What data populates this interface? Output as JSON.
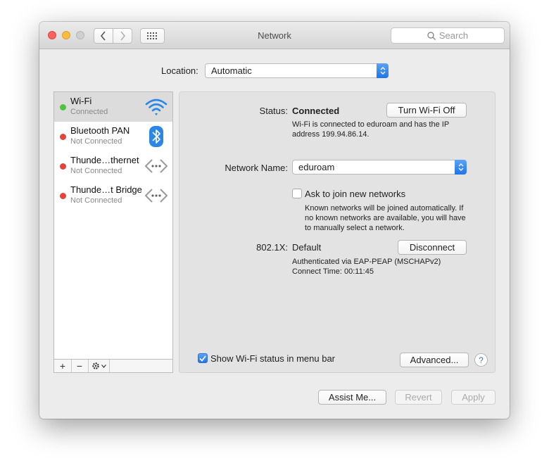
{
  "window": {
    "title": "Network"
  },
  "search": {
    "placeholder": "Search"
  },
  "location": {
    "label": "Location:",
    "value": "Automatic"
  },
  "services": [
    {
      "name": "Wi-Fi",
      "status": "Connected",
      "state": "green",
      "icon": "wifi-icon"
    },
    {
      "name": "Bluetooth PAN",
      "status": "Not Connected",
      "state": "red",
      "icon": "bluetooth-icon"
    },
    {
      "name": "Thunde…thernet",
      "status": "Not Connected",
      "state": "red",
      "icon": "thunderbolt-ethernet-icon"
    },
    {
      "name": "Thunde…t Bridge",
      "status": "Not Connected",
      "state": "red",
      "icon": "thunderbolt-bridge-icon"
    }
  ],
  "sidebar_toolbar": {
    "add": "+",
    "remove": "−"
  },
  "detail": {
    "status_label": "Status:",
    "status_value": "Connected",
    "turn_off_button": "Turn Wi-Fi Off",
    "status_desc_1": "Wi-Fi is connected to eduroam and has the IP",
    "status_desc_2": "address 199.94.86.14.",
    "network_name_label": "Network Name:",
    "network_name_value": "eduroam",
    "ask_join_label": "Ask to join new networks",
    "ask_join_checked": false,
    "ask_join_desc_1": "Known networks will be joined automatically. If",
    "ask_join_desc_2": "no known networks are available, you will have",
    "ask_join_desc_3": "to manually select a network.",
    "dot1x_label": "802.1X:",
    "dot1x_value": "Default",
    "disconnect_button": "Disconnect",
    "auth_desc": "Authenticated via EAP-PEAP (MSCHAPv2)",
    "connect_time": "Connect Time: 00:11:45",
    "show_status_label": "Show Wi-Fi status in menu bar",
    "show_status_checked": true,
    "advanced_button": "Advanced...",
    "help_button": "?"
  },
  "footer": {
    "assist_button": "Assist Me...",
    "revert_button": "Revert",
    "apply_button": "Apply"
  },
  "colors": {
    "accent": "#1f74e8",
    "connected": "#4cc53e",
    "disconnected": "#e3453b"
  }
}
